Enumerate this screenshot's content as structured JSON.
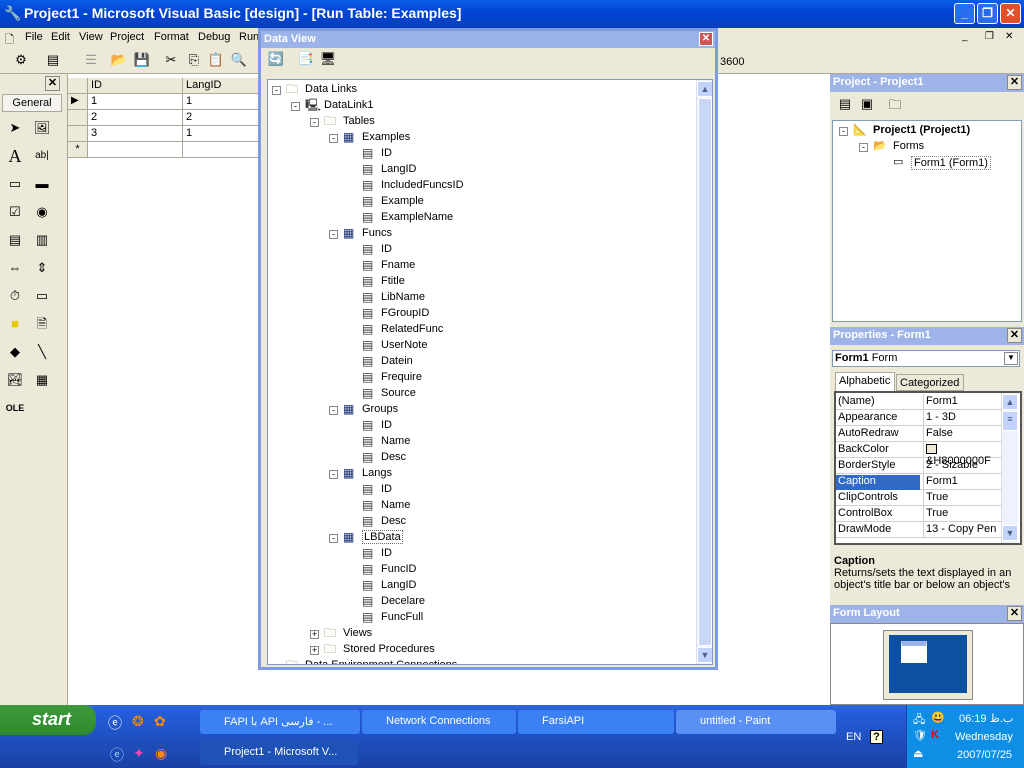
{
  "window": {
    "title": "Project1 - Microsoft Visual Basic [design] - [Run Table: Examples]",
    "min": "_",
    "restore": "❐",
    "close": "✕",
    "child_min": "_",
    "child_restore": "❐",
    "child_close": "✕"
  },
  "menu": [
    "File",
    "Edit",
    "View",
    "Project",
    "Format",
    "Debug",
    "Run"
  ],
  "toolbar": {
    "coords": "3600"
  },
  "grid": {
    "columns": [
      "ID",
      "LangID"
    ],
    "rows": [
      [
        "1",
        "1"
      ],
      [
        "2",
        "2"
      ],
      [
        "3",
        "1"
      ]
    ],
    "new_row_marker": "*",
    "current_row_marker": "▶"
  },
  "toolbox": {
    "tab": "General"
  },
  "data_view": {
    "title": "Data View",
    "close": "✕",
    "tree": [
      {
        "label": "Data Links",
        "depth": 0,
        "icon": "folder",
        "exp": "-"
      },
      {
        "label": "DataLink1",
        "depth": 1,
        "icon": "datalink",
        "exp": "-"
      },
      {
        "label": "Tables",
        "depth": 2,
        "icon": "folder",
        "exp": "-"
      },
      {
        "label": "Examples",
        "depth": 3,
        "icon": "table",
        "exp": "-"
      },
      {
        "label": "ID",
        "depth": 4,
        "icon": "field"
      },
      {
        "label": "LangID",
        "depth": 4,
        "icon": "field"
      },
      {
        "label": "IncludedFuncsID",
        "depth": 4,
        "icon": "field"
      },
      {
        "label": "Example",
        "depth": 4,
        "icon": "field"
      },
      {
        "label": "ExampleName",
        "depth": 4,
        "icon": "field"
      },
      {
        "label": "Funcs",
        "depth": 3,
        "icon": "table",
        "exp": "-"
      },
      {
        "label": "ID",
        "depth": 4,
        "icon": "field"
      },
      {
        "label": "Fname",
        "depth": 4,
        "icon": "field"
      },
      {
        "label": "Ftitle",
        "depth": 4,
        "icon": "field"
      },
      {
        "label": "LibName",
        "depth": 4,
        "icon": "field"
      },
      {
        "label": "FGroupID",
        "depth": 4,
        "icon": "field"
      },
      {
        "label": "RelatedFunc",
        "depth": 4,
        "icon": "field"
      },
      {
        "label": "UserNote",
        "depth": 4,
        "icon": "field"
      },
      {
        "label": "Datein",
        "depth": 4,
        "icon": "field"
      },
      {
        "label": "Frequire",
        "depth": 4,
        "icon": "field"
      },
      {
        "label": "Source",
        "depth": 4,
        "icon": "field"
      },
      {
        "label": "Groups",
        "depth": 3,
        "icon": "table",
        "exp": "-"
      },
      {
        "label": "ID",
        "depth": 4,
        "icon": "field"
      },
      {
        "label": "Name",
        "depth": 4,
        "icon": "field"
      },
      {
        "label": "Desc",
        "depth": 4,
        "icon": "field"
      },
      {
        "label": "Langs",
        "depth": 3,
        "icon": "table",
        "exp": "-"
      },
      {
        "label": "ID",
        "depth": 4,
        "icon": "field"
      },
      {
        "label": "Name",
        "depth": 4,
        "icon": "field"
      },
      {
        "label": "Desc",
        "depth": 4,
        "icon": "field"
      },
      {
        "label": "LBData",
        "depth": 3,
        "icon": "table",
        "exp": "-",
        "selected": true
      },
      {
        "label": "ID",
        "depth": 4,
        "icon": "field"
      },
      {
        "label": "FuncID",
        "depth": 4,
        "icon": "field"
      },
      {
        "label": "LangID",
        "depth": 4,
        "icon": "field"
      },
      {
        "label": "Decelare",
        "depth": 4,
        "icon": "field"
      },
      {
        "label": "FuncFull",
        "depth": 4,
        "icon": "field"
      },
      {
        "label": "Views",
        "depth": 2,
        "icon": "folder",
        "exp": "+"
      },
      {
        "label": "Stored Procedures",
        "depth": 2,
        "icon": "folder",
        "exp": "+"
      },
      {
        "label": "Data Environment Connections",
        "depth": 0,
        "icon": "folder"
      }
    ]
  },
  "project": {
    "title": "Project - Project1",
    "close": "✕",
    "root": "Project1 (Project1)",
    "forms": "Forms",
    "form1": "Form1 (Form1)"
  },
  "properties": {
    "title": "Properties - Form1",
    "close": "✕",
    "object_name": "Form1",
    "object_type": "Form",
    "tabs": [
      "Alphabetic",
      "Categorized"
    ],
    "rows": [
      [
        "(Name)",
        "Form1"
      ],
      [
        "Appearance",
        "1 - 3D"
      ],
      [
        "AutoRedraw",
        "False"
      ],
      [
        "BackColor",
        "&H8000000F"
      ],
      [
        "BorderStyle",
        "2 - Sizable"
      ],
      [
        "Caption",
        "Form1"
      ],
      [
        "ClipControls",
        "True"
      ],
      [
        "ControlBox",
        "True"
      ],
      [
        "DrawMode",
        "13 - Copy Pen"
      ]
    ],
    "selected": "Caption",
    "desc_title": "Caption",
    "desc_text": "Returns/sets the text displayed in an object's title bar or below an object's"
  },
  "form_layout": {
    "title": "Form Layout",
    "close": "✕"
  },
  "taskbar": {
    "start": "start",
    "tasks": [
      "FAPI با API فارسی - ...",
      "Network Connections",
      "FarsiAPI",
      "untitled - Paint",
      "Project1 - Microsoft V..."
    ],
    "lang": "EN",
    "time": "06:19 ب.ظ",
    "day": "Wednesday",
    "date": "2007/07/25"
  },
  "colors": {
    "accent": "#0a5ee6",
    "selection": "#316ac5",
    "taskbar": "#245edb",
    "inactive_title": "#9eb3e8"
  }
}
